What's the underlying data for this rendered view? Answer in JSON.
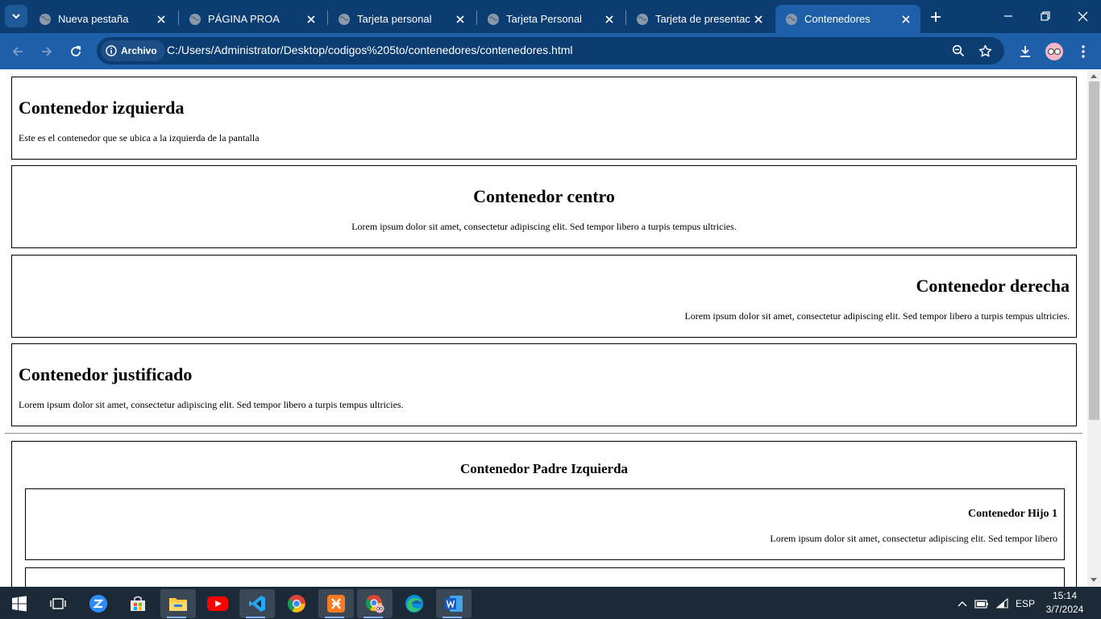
{
  "browser": {
    "tabs": [
      {
        "title": "Nueva pestaña",
        "active": false
      },
      {
        "title": "PÁGINA PROA",
        "active": false
      },
      {
        "title": "Tarjeta personal",
        "active": false
      },
      {
        "title": "Tarjeta Personal",
        "active": false
      },
      {
        "title": "Tarjeta de presentació",
        "active": false
      },
      {
        "title": "Contenedores",
        "active": true
      }
    ],
    "security_chip": "Archivo",
    "url": "C:/Users/Administrator/Desktop/codigos%205to/contenedores/contenedores.html",
    "colors": {
      "tabbar": "#0b3c72",
      "toolbar": "#1d5fa8",
      "omnibox": "#0b3c72"
    }
  },
  "page": {
    "left_box": {
      "title": "Contenedor izquierda",
      "text": "Este es el contenedor que se ubica a la izquierda de la pantalla"
    },
    "center_box": {
      "title": "Contenedor centro",
      "text": "Lorem ipsum dolor sit amet, consectetur adipiscing elit. Sed tempor libero a turpis tempus ultricies."
    },
    "right_box": {
      "title": "Contenedor derecha",
      "text": "Lorem ipsum dolor sit amet, consectetur adipiscing elit. Sed tempor libero a turpis tempus ultricies."
    },
    "justify_box": {
      "title": "Contenedor justificado",
      "text": "Lorem ipsum dolor sit amet, consectetur adipiscing elit. Sed tempor libero a turpis tempus ultricies."
    },
    "parent_box": {
      "title": "Contenedor Padre Izquierda",
      "children": [
        {
          "title": "Contenedor Hijo 1",
          "text": "Lorem ipsum dolor sit amet, consectetur adipiscing elit. Sed tempor libero"
        },
        {
          "title": "",
          "text": ""
        }
      ]
    }
  },
  "taskbar": {
    "apps": [
      "windows-start-icon",
      "task-view-icon",
      "zoom-icon",
      "microsoft-store-icon",
      "file-explorer-icon",
      "youtube-icon",
      "vscode-icon",
      "chrome-icon",
      "xampp-icon",
      "chrome-profile-icon",
      "edge-icon",
      "word-icon"
    ],
    "language": "ESP",
    "time": "15:14",
    "date": "3/7/2024"
  }
}
